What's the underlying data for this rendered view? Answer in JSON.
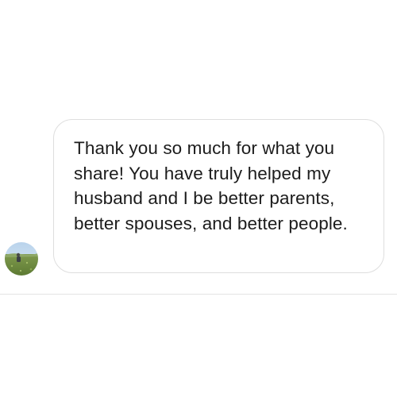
{
  "conversation": {
    "incoming_message": {
      "text": "Thank you so much for what you share! You have truly helped my husband and I be better parents, better spouses, and better people.",
      "sender_avatar_icon": "sender-avatar-photo"
    }
  },
  "colors": {
    "background": "#ffffff",
    "bubble_border": "#dedede",
    "text": "#1c1c1c",
    "divider": "#e4e4e4"
  }
}
